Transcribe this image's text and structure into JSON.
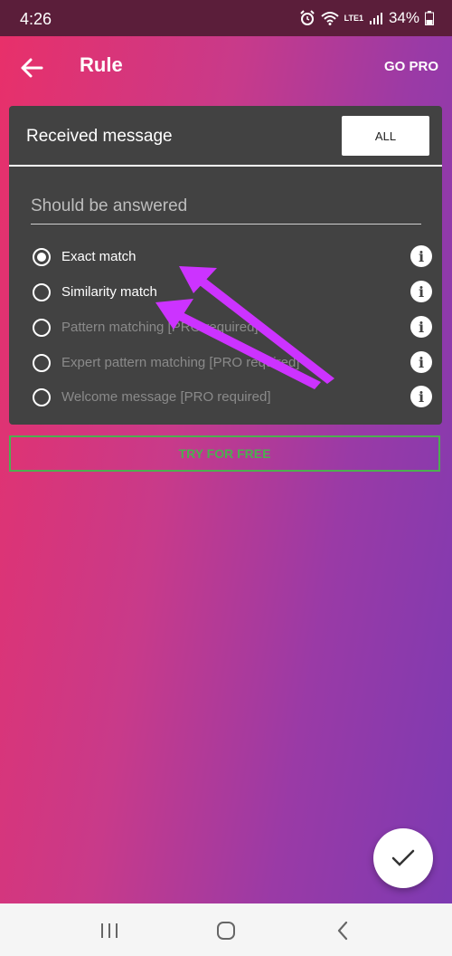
{
  "status_bar": {
    "time": "4:26",
    "battery": "34%",
    "network": "LTE1"
  },
  "app_bar": {
    "title": "Rule",
    "go_pro": "GO PRO"
  },
  "card": {
    "label": "Received message",
    "all_button": "ALL",
    "input": {
      "value": "",
      "placeholder": "Should be answered"
    },
    "options": [
      {
        "label": "Exact match",
        "checked": true,
        "enabled": true
      },
      {
        "label": "Similarity match",
        "checked": false,
        "enabled": true
      },
      {
        "label": "Pattern matching [PRO required]",
        "checked": false,
        "enabled": false
      },
      {
        "label": "Expert pattern matching [PRO required]",
        "checked": false,
        "enabled": false
      },
      {
        "label": "Welcome message [PRO required]",
        "checked": false,
        "enabled": false
      }
    ]
  },
  "try_button": "TRY FOR FREE",
  "colors": {
    "gradient_start": "#e8306a",
    "gradient_end": "#7d3ab2",
    "card": "#424242",
    "try_border": "#4caf50",
    "annotation_arrow": "#cc33ff"
  },
  "icons": {
    "back": "arrow-left-icon",
    "info": "info-icon",
    "fab": "check-icon",
    "nav_recent": "recent-apps-icon",
    "nav_home": "home-icon",
    "nav_back": "nav-back-icon"
  }
}
